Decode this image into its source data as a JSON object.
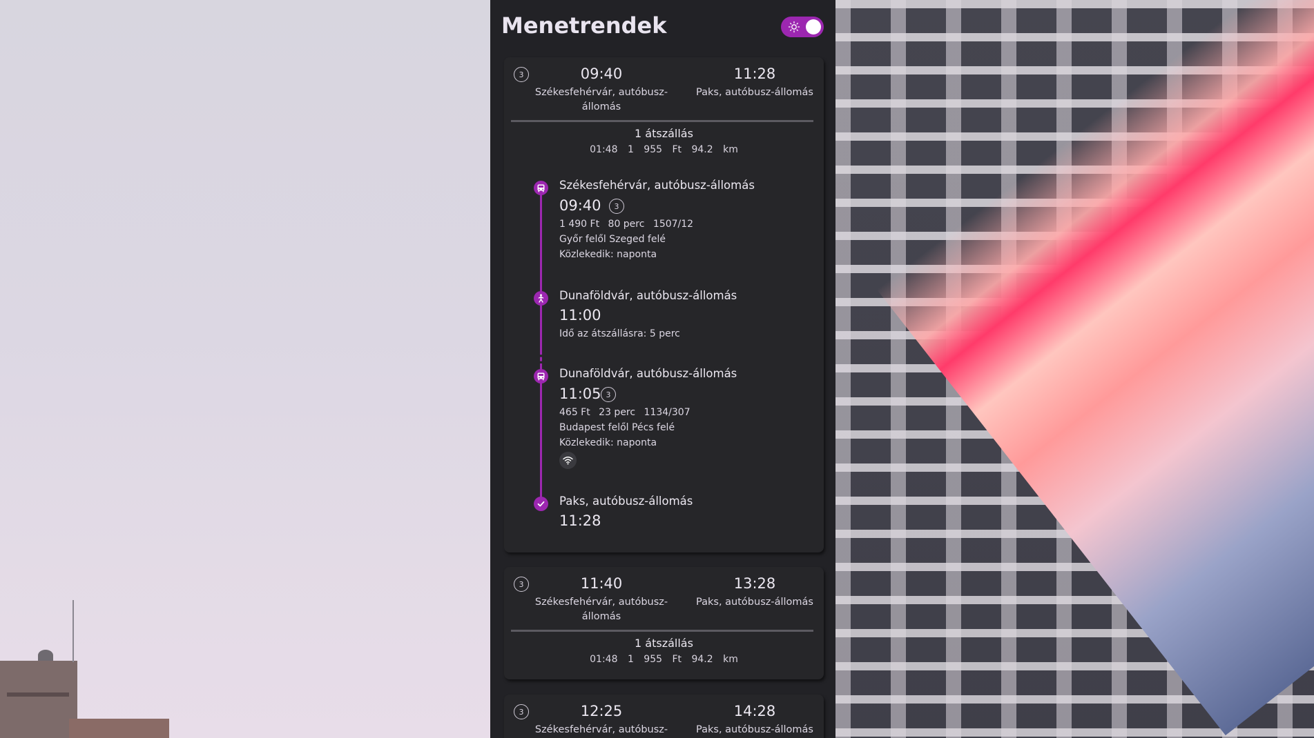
{
  "app": {
    "title": "Menetrendek"
  },
  "theme_toggle": {
    "icon": "sun-icon",
    "state": "dark"
  },
  "colors": {
    "accent": "#9c27b0",
    "panel_bg": "#222226",
    "card_bg": "#262629"
  },
  "results": [
    {
      "operator_badge": "3",
      "dep_time": "09:40",
      "dep_station": "Székesfehérvár, autóbusz-állomás",
      "arr_time": "11:28",
      "arr_station": "Paks, autóbusz-állomás",
      "transfers": "1 átszállás",
      "duration": "01:48",
      "price": "1 955 Ft",
      "distance": "94.2 km",
      "expanded": true,
      "legs": [
        {
          "type": "bus",
          "station": "Székesfehérvár, autóbusz-állomás",
          "time": "09:40",
          "operator_badge": "3",
          "price": "1 490 Ft",
          "duration": "80 perc",
          "line": "1507/12",
          "direction": "Győr felől Szeged felé",
          "runs": "Közlekedik: naponta"
        },
        {
          "type": "walk",
          "station": "Dunaföldvár, autóbusz-állomás",
          "time": "11:00",
          "note": "Idő az átszállásra: 5 perc"
        },
        {
          "type": "bus",
          "station": "Dunaföldvár, autóbusz-állomás",
          "time": "11:05",
          "operator_badge": "3",
          "price": "465 Ft",
          "duration": "23 perc",
          "line": "1134/307",
          "direction": "Budapest felől Pécs felé",
          "runs": "Közlekedik: naponta",
          "amenity": "wifi-icon"
        },
        {
          "type": "arrival",
          "station": "Paks, autóbusz-állomás",
          "time": "11:28"
        }
      ]
    },
    {
      "operator_badge": "3",
      "dep_time": "11:40",
      "dep_station": "Székesfehérvár, autóbusz-állomás",
      "arr_time": "13:28",
      "arr_station": "Paks, autóbusz-állomás",
      "transfers": "1 átszállás",
      "duration": "01:48",
      "price": "1 955 Ft",
      "distance": "94.2 km",
      "expanded": false
    },
    {
      "operator_badge": "3",
      "dep_time": "12:25",
      "dep_station": "Székesfehérvár, autóbusz-",
      "arr_time": "14:28",
      "arr_station": "Paks, autóbusz-állomás",
      "expanded": false
    }
  ]
}
